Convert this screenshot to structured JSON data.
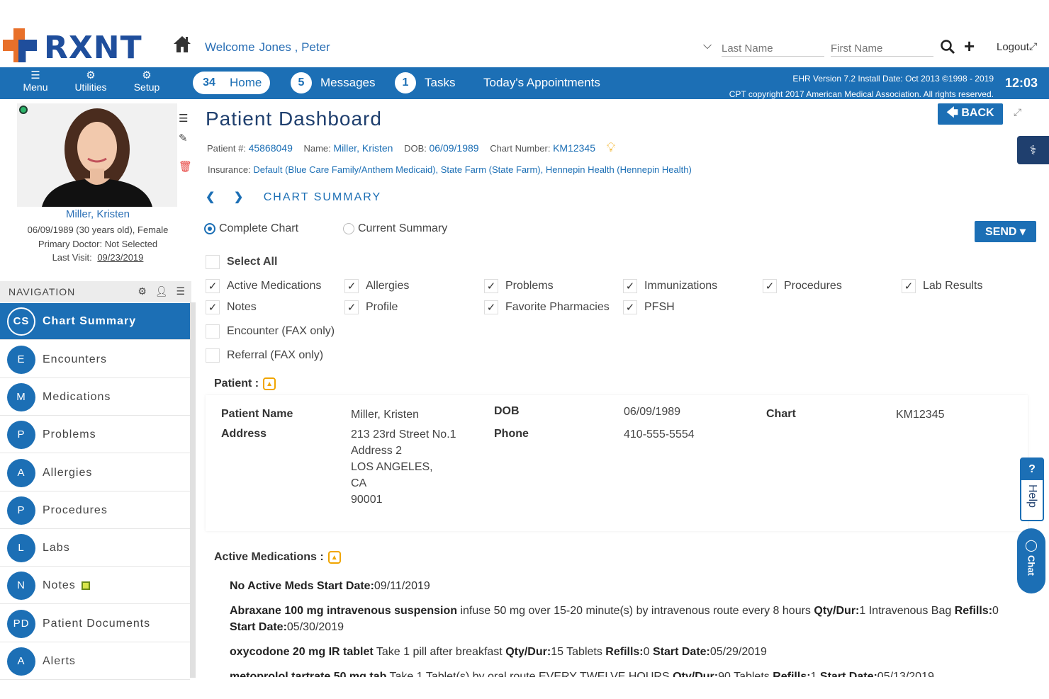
{
  "header": {
    "logo_text": "RXNT",
    "welcome_label": "Welcome",
    "welcome_user": "Jones , Peter",
    "last_name_placeholder": "Last Name",
    "first_name_placeholder": "First Name",
    "logout_label": "Logout"
  },
  "navbar": {
    "tools": [
      {
        "label": "Menu",
        "icon": "menu-icon"
      },
      {
        "label": "Utilities",
        "icon": "gear-icon"
      },
      {
        "label": "Setup",
        "icon": "gears-icon"
      }
    ],
    "home": {
      "count": "34",
      "label": "Home"
    },
    "messages": {
      "count": "5",
      "label": "Messages"
    },
    "tasks": {
      "count": "1",
      "label": "Tasks"
    },
    "appointments_label": "Today's Appointments",
    "ehr_line1": "EHR Version 7.2 Install Date: Oct 2013 ©1998 - 2019",
    "ehr_line2": "CPT copyright 2017 American Medical Association. All rights reserved.",
    "clock": "12:03"
  },
  "patient_card": {
    "name": "Miller, Kristen",
    "dob_line": "06/09/1989 (30 years old), Female",
    "doctor_line": "Primary Doctor: Not Selected",
    "last_visit_label": "Last Visit:",
    "last_visit": "09/23/2019"
  },
  "navigation": {
    "title": "NAVIGATION",
    "items": [
      {
        "badge": "CS",
        "label": "Chart Summary",
        "active": true
      },
      {
        "badge": "E",
        "label": "Encounters"
      },
      {
        "badge": "M",
        "label": "Medications"
      },
      {
        "badge": "P",
        "label": "Problems"
      },
      {
        "badge": "A",
        "label": "Allergies"
      },
      {
        "badge": "P",
        "label": "Procedures"
      },
      {
        "badge": "L",
        "label": "Labs"
      },
      {
        "badge": "N",
        "label": "Notes"
      },
      {
        "badge": "PD",
        "label": "Patient Documents"
      },
      {
        "badge": "A",
        "label": "Alerts"
      }
    ]
  },
  "main": {
    "title": "Patient Dashboard",
    "back_label": "BACK",
    "patient_num_label": "Patient #:",
    "patient_num": "45868049",
    "name_label": "Name:",
    "name": "Miller, Kristen",
    "dob_label": "DOB:",
    "dob": "06/09/1989",
    "chart_num_label": "Chart Number:",
    "chart_num": "KM12345",
    "insurance_label": "Insurance:",
    "insurance": "Default (Blue Care Family/Anthem Medicaid), State Farm (State Farm), Hennepin Health (Hennepin Health)",
    "chart_summary_label": "CHART SUMMARY",
    "radio_complete": "Complete Chart",
    "radio_current": "Current Summary",
    "send_label": "SEND",
    "select_all": "Select All",
    "checkboxes": [
      {
        "label": "Active Medications",
        "checked": true
      },
      {
        "label": "Allergies",
        "checked": true
      },
      {
        "label": "Problems",
        "checked": true
      },
      {
        "label": "Immunizations",
        "checked": true
      },
      {
        "label": "Procedures",
        "checked": true
      },
      {
        "label": "Lab Results",
        "checked": true
      },
      {
        "label": "Notes",
        "checked": true
      },
      {
        "label": "Profile",
        "checked": true
      },
      {
        "label": "Favorite Pharmacies",
        "checked": true
      },
      {
        "label": "PFSH",
        "checked": true
      },
      {
        "label": "Encounter (FAX only)",
        "checked": false
      },
      {
        "label": "Referral (FAX only)",
        "checked": false
      }
    ],
    "patient_section": {
      "title": "Patient :",
      "patient_name_label": "Patient Name",
      "patient_name": "Miller, Kristen",
      "address_label": "Address",
      "address_lines": [
        "213 23rd Street No.1",
        "Address 2",
        "LOS ANGELES,",
        "CA",
        "90001"
      ],
      "dob_label": "DOB",
      "dob": "06/09/1989",
      "phone_label": "Phone",
      "phone": "410-555-5554",
      "chart_label": "Chart",
      "chart": "KM12345"
    },
    "meds_section": {
      "title": "Active Medications :",
      "items": [
        {
          "bold": "No Active Meds Start Date:",
          "text": "09/11/2019"
        },
        {
          "bold": "Abraxane 100 mg intravenous suspension",
          "text": " infuse 50 mg over 15-20 minute(s) by intravenous route every 8 hours ",
          "qty_label": "Qty/Dur:",
          "qty": "1 Intravenous Bag ",
          "refills_label": "Refills:",
          "refills": "0 ",
          "start_label": "Start Date:",
          "start": "05/30/2019"
        },
        {
          "bold": "oxycodone 20 mg IR tablet",
          "text": " Take 1 pill after breakfast ",
          "qty_label": "Qty/Dur:",
          "qty": "15 Tablets ",
          "refills_label": "Refills:",
          "refills": "0 ",
          "start_label": "Start Date:",
          "start": "05/29/2019"
        },
        {
          "bold": "metoprolol tartrate 50 mg tab",
          "text": " Take 1 Tablet(s) by oral route EVERY TWELVE HOURS ",
          "qty_label": "Qty/Dur:",
          "qty": "90 Tablets ",
          "refills_label": "Refills:",
          "refills": "1 ",
          "start_label": "Start Date:",
          "start": "05/13/2019"
        }
      ]
    }
  },
  "help_label": "Help",
  "chat_label": "Chat",
  "colors": {
    "primary": "#1c6fb5",
    "accent": "#e8702a",
    "brand_dark": "#1f4e9c",
    "warning": "#f0a500"
  }
}
